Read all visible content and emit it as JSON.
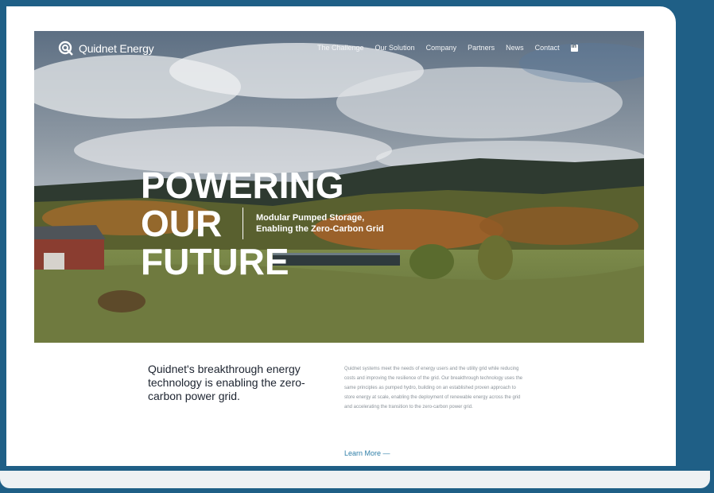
{
  "brand": {
    "name": "Quidnet Energy"
  },
  "nav": {
    "items": [
      "The Challenge",
      "Our Solution",
      "Company",
      "Partners",
      "News",
      "Contact"
    ]
  },
  "hero": {
    "headline": [
      "POWERING",
      "OUR",
      "FUTURE"
    ],
    "tagline": [
      "Modular Pumped Storage,",
      "Enabling the Zero-Carbon Grid"
    ]
  },
  "intro": {
    "text": "Quidnet's breakthrough energy technology is enabling the zero-carbon power grid.",
    "body": "Quidnet systems meet the needs of energy users and the utility grid while reducing costs and improving the resilience of the grid. Our breakthrough technology uses the same principles as pumped hydro, building on an established proven approach to store energy at scale, enabling the deployment of renewable energy across the grid and accelerating the transition to the zero-carbon power grid.",
    "learn_more": "Learn More —"
  },
  "colors": {
    "page_background": "#1f5f86",
    "link": "#2f7fa8",
    "text_dark": "#1d2430"
  }
}
